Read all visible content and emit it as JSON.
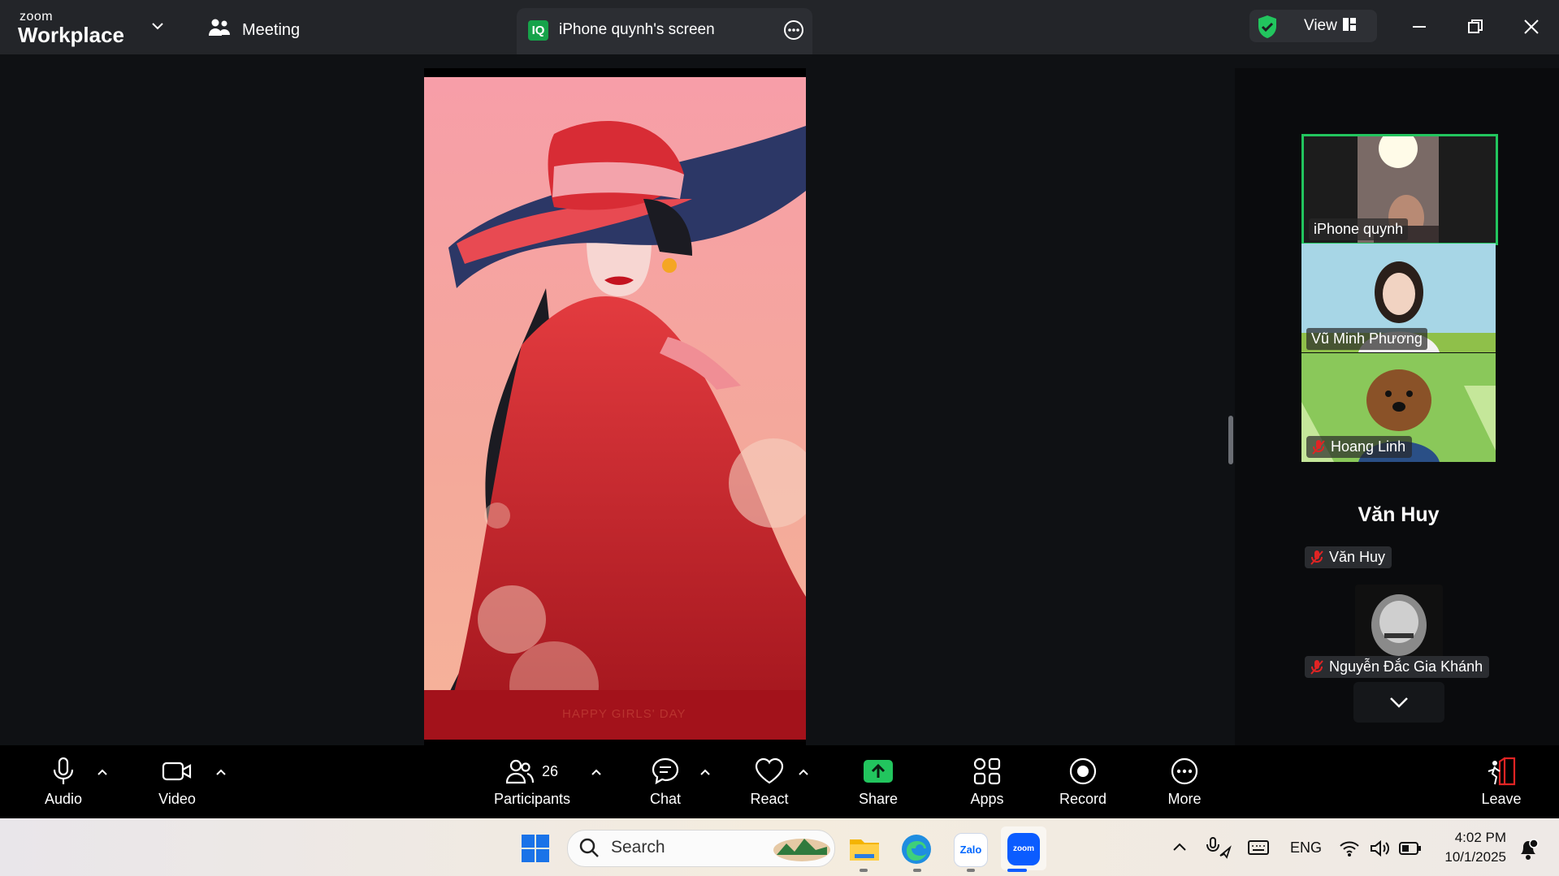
{
  "titlebar": {
    "logo_small": "zoom",
    "logo_big": "Workplace",
    "meeting_label": "Meeting",
    "share_badge": "IQ",
    "share_title": "iPhone quynh's screen",
    "view_label": "View"
  },
  "poster": {
    "caption": "HAPPY GIRLS' DAY"
  },
  "gallery": {
    "tiles": [
      {
        "name": "iPhone quynh",
        "active": true
      },
      {
        "name": "Vũ Minh Phương"
      },
      {
        "name": "Hoang Linh",
        "muted": true
      }
    ],
    "no_video_big_name": "Văn Huy",
    "no_video_chip": "Văn Huy",
    "last_chip": "Nguyễn Đắc Gia Khánh"
  },
  "toolbar": {
    "audio": "Audio",
    "video": "Video",
    "participants": "Participants",
    "participants_count": "26",
    "chat": "Chat",
    "react": "React",
    "share": "Share",
    "apps": "Apps",
    "record": "Record",
    "more": "More",
    "leave": "Leave"
  },
  "taskbar": {
    "search": "Search",
    "zalo": "Zalo",
    "zoom": "zoom",
    "lang": "ENG",
    "time": "4:02 PM",
    "date": "10/1/2025"
  },
  "colors": {
    "accent_green": "#22c55e",
    "share_green": "#16a34a",
    "leave_red": "#e02424"
  }
}
